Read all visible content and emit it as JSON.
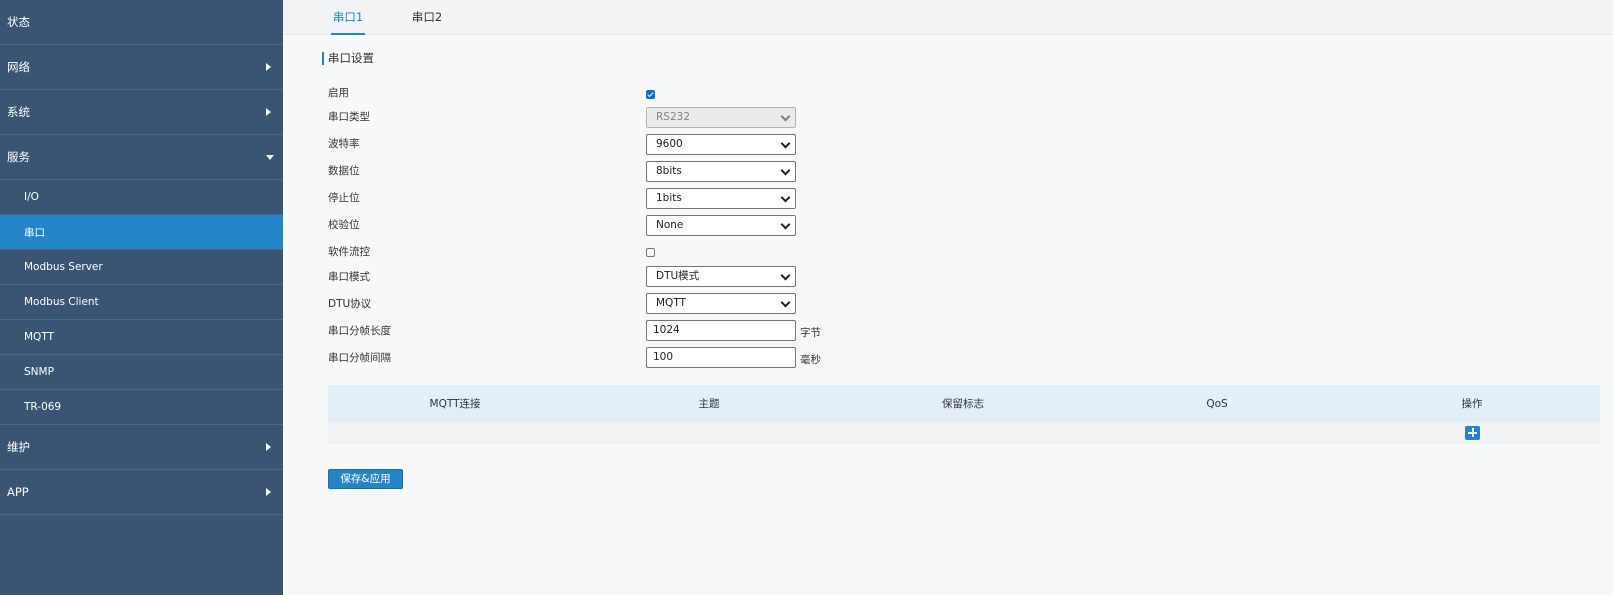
{
  "sidebar": {
    "items": [
      {
        "label": "状态"
      },
      {
        "label": "网络"
      },
      {
        "label": "系统"
      },
      {
        "label": "服务"
      },
      {
        "label": "维护"
      },
      {
        "label": "APP"
      }
    ],
    "service_sub": [
      {
        "label": "I/O"
      },
      {
        "label": "串口"
      },
      {
        "label": "Modbus Server"
      },
      {
        "label": "Modbus Client"
      },
      {
        "label": "MQTT"
      },
      {
        "label": "SNMP"
      },
      {
        "label": "TR-069"
      }
    ],
    "active_sub": "串口"
  },
  "tabs": [
    {
      "label": "串口1"
    },
    {
      "label": "串口2"
    }
  ],
  "section_title": "串口设置",
  "form": {
    "enable": {
      "label": "启用",
      "checked": true
    },
    "serial_type": {
      "label": "串口类型",
      "value": "RS232"
    },
    "baud_rate": {
      "label": "波特率",
      "value": "9600"
    },
    "data_bits": {
      "label": "数据位",
      "value": "8bits"
    },
    "stop_bits": {
      "label": "停止位",
      "value": "1bits"
    },
    "parity": {
      "label": "校验位",
      "value": "None"
    },
    "soft_flow": {
      "label": "软件流控",
      "checked": false
    },
    "serial_mode": {
      "label": "串口模式",
      "value": "DTU模式"
    },
    "dtu_protocol": {
      "label": "DTU协议",
      "value": "MQTT"
    },
    "frame_length": {
      "label": "串口分帧长度",
      "value": "1024",
      "unit": "字节"
    },
    "frame_interval": {
      "label": "串口分帧间隔",
      "value": "100",
      "unit": "毫秒"
    }
  },
  "table": {
    "headers": [
      "MQTT连接",
      "主题",
      "保留标志",
      "QoS",
      "操作"
    ]
  },
  "save_label": "保存&应用",
  "icons": {
    "add": "plus-icon",
    "expand": "caret-right-icon",
    "collapse": "caret-down-icon"
  },
  "colors": {
    "sidebar_bg": "#3a5573",
    "accent": "#2484c8",
    "table_header": "#e2eef8"
  }
}
